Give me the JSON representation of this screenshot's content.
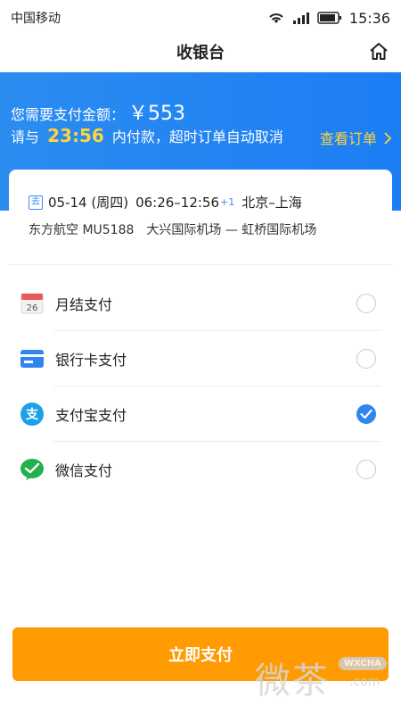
{
  "statusbar": {
    "carrier": "中国移动",
    "time": "15:36"
  },
  "nav": {
    "title": "收银台"
  },
  "banner": {
    "amount_label": "您需要支付金额：",
    "amount": "￥553",
    "count_prefix": "请与",
    "countdown": "23:56",
    "count_suffix": "内付款，超时订单自动取消",
    "order_link": "查看订单"
  },
  "flight": {
    "badge": "去",
    "date": "05-14 (周四)",
    "time": "06:26–12:56",
    "day_offset": "+1",
    "route": "北京–上海",
    "detail": "东方航空 MU5188　大兴国际机场 — 虹桥国际机场"
  },
  "payment_methods": [
    {
      "label": "月结支付",
      "icon": "calendar-icon",
      "calendar_day": "26",
      "selected": false
    },
    {
      "label": "银行卡支付",
      "icon": "bank-card-icon",
      "selected": false
    },
    {
      "label": "支付宝支付",
      "icon": "alipay-icon",
      "icon_text": "支",
      "selected": true
    },
    {
      "label": "微信支付",
      "icon": "wechat-pay-icon",
      "selected": false
    }
  ],
  "pay_button": {
    "label": "立即支付"
  },
  "watermark": {
    "text": "微茶",
    "badge": "WXCHA",
    "domain": ".com"
  },
  "colors": {
    "primary": "#2b8cf0",
    "accent": "#ff9a00",
    "highlight": "#ffd43a"
  }
}
